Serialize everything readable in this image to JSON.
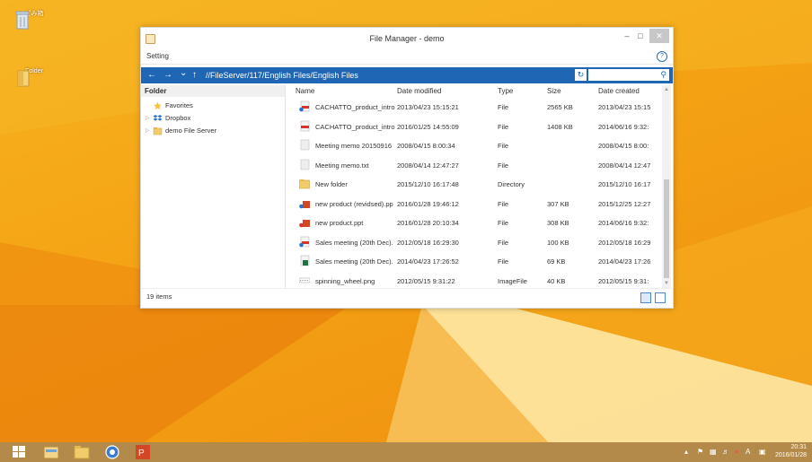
{
  "desktop": {
    "icons": [
      {
        "label": "ごみ箱",
        "icon": "recycle-bin-icon"
      },
      {
        "label": "Folder",
        "icon": "folder-icon"
      }
    ]
  },
  "window": {
    "title": "File Manager - demo",
    "controls": {
      "minimize": "–",
      "maximize": "□",
      "close": "✕"
    },
    "menu": {
      "setting": "Setting",
      "help": "?"
    },
    "nav": {
      "back": "←",
      "forward": "→",
      "dropdown": "⌄",
      "up": "↑",
      "path": "//FileServer/117/English Files/English Files",
      "refresh": "↻",
      "search_placeholder": ""
    },
    "sidebar": {
      "header": "Folder",
      "items": [
        {
          "label": "Favorites",
          "icon": "star-icon"
        },
        {
          "label": "Dropbox",
          "icon": "dropbox-icon"
        },
        {
          "label": "demo File Server",
          "icon": "folder-icon"
        }
      ]
    },
    "columns": {
      "name": "Name",
      "date_modified": "Date modified",
      "type": "Type",
      "size": "Size",
      "date_created": "Date created"
    },
    "files": [
      {
        "name": "CACHATTO_product_intro",
        "modified": "2013/04/23 15:15:21",
        "type": "File",
        "size": "2565 KB",
        "created": "2013/04/23 15:15",
        "icon": "pdf-sync-icon"
      },
      {
        "name": "CACHATTO_product_intro",
        "modified": "2016/01/25 14:55:09",
        "type": "File",
        "size": "1408 KB",
        "created": "2014/06/16 9:32:",
        "icon": "pdf-icon"
      },
      {
        "name": "Meeting memo 20150916",
        "modified": "2008/04/15 8:00:34",
        "type": "File",
        "size": "",
        "created": "2008/04/15 8:00:",
        "icon": "text-file-icon"
      },
      {
        "name": "Meeting memo.txt",
        "modified": "2008/04/14 12:47:27",
        "type": "File",
        "size": "",
        "created": "2008/04/14 12:47",
        "icon": "text-file-icon"
      },
      {
        "name": "New folder",
        "modified": "2015/12/10 16:17:48",
        "type": "Directory",
        "size": "",
        "created": "2015/12/10 16:17",
        "icon": "folder-icon"
      },
      {
        "name": "new product (revidsed).pp",
        "modified": "2016/01/28 19:46:12",
        "type": "File",
        "size": "307 KB",
        "created": "2015/12/25 12:27",
        "icon": "ppt-sync-icon"
      },
      {
        "name": "new product.ppt",
        "modified": "2016/01/28 20:10:34",
        "type": "File",
        "size": "308 KB",
        "created": "2014/06/16 9:32:",
        "icon": "ppt-sync-icon"
      },
      {
        "name": "Sales meeting (20th Dec).",
        "modified": "2012/05/18 16:29:30",
        "type": "File",
        "size": "100 KB",
        "created": "2012/05/18 16:29",
        "icon": "pdf-sync-icon"
      },
      {
        "name": "Sales meeting (20th Dec).",
        "modified": "2014/04/23 17:26:52",
        "type": "File",
        "size": "69 KB",
        "created": "2014/04/23 17:26",
        "icon": "excel-icon"
      },
      {
        "name": "spinning_wheel.png",
        "modified": "2012/05/15 9:31:22",
        "type": "ImageFile",
        "size": "40 KB",
        "created": "2012/05/15 9:31:",
        "icon": "image-file-icon"
      }
    ],
    "status": {
      "count": "19 items"
    }
  },
  "taskbar": {
    "apps": [
      "windows-start-icon",
      "file-explorer-icon",
      "folder-icon",
      "browser-icon",
      "powerpoint-icon"
    ],
    "tray": {
      "ime": "A",
      "time": "20:31",
      "date": "2016/01/28"
    }
  },
  "colors": {
    "accent": "#1f67b4",
    "desktop": "#f4a214",
    "taskbar": "#b38a4a"
  }
}
